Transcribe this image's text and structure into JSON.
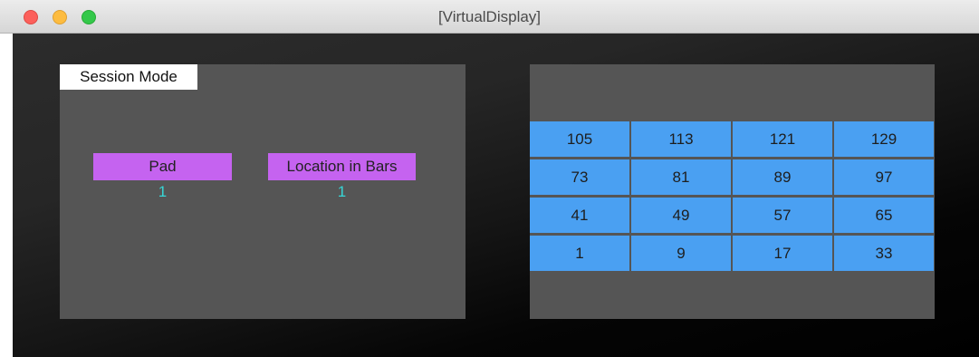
{
  "window": {
    "title": "[VirtualDisplay]"
  },
  "session": {
    "mode_label": "Session Mode",
    "pad_label": "Pad",
    "pad_value": "1",
    "location_label": "Location in Bars",
    "location_value": "1"
  },
  "pad_grid": {
    "rows": [
      [
        "105",
        "113",
        "121",
        "129"
      ],
      [
        "73",
        "81",
        "89",
        "97"
      ],
      [
        "41",
        "49",
        "57",
        "65"
      ],
      [
        "1",
        "9",
        "17",
        "33"
      ]
    ]
  },
  "colors": {
    "tag_purple": "#c563f0",
    "pad_blue": "#4aa0f2",
    "value_cyan": "#37d6d6",
    "panel_gray": "#555555"
  }
}
